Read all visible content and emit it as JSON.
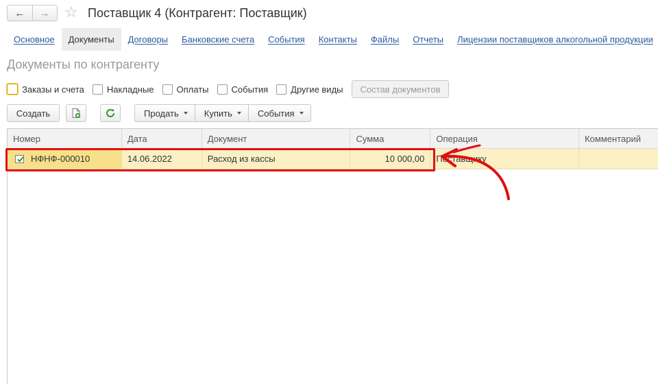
{
  "header": {
    "title": "Поставщик 4 (Контрагент: Поставщик)",
    "back_icon": "←",
    "forward_icon": "→",
    "favorite_icon": "☆"
  },
  "tabs": [
    {
      "label": "Основное",
      "active": false
    },
    {
      "label": "Документы",
      "active": true
    },
    {
      "label": "Договоры",
      "active": false
    },
    {
      "label": "Банковские счета",
      "active": false
    },
    {
      "label": "События",
      "active": false
    },
    {
      "label": "Контакты",
      "active": false
    },
    {
      "label": "Файлы",
      "active": false
    },
    {
      "label": "Отчеты",
      "active": false
    },
    {
      "label": "Лицензии поставщиков алкогольной продукции",
      "active": false
    }
  ],
  "section_title": "Документы по контрагенту",
  "filters": {
    "checkboxes": [
      {
        "label": "Заказы и счета",
        "checked": false
      },
      {
        "label": "Накладные",
        "checked": false
      },
      {
        "label": "Оплаты",
        "checked": false
      },
      {
        "label": "События",
        "checked": false
      },
      {
        "label": "Другие виды",
        "checked": false
      }
    ],
    "composition_button": "Состав документов"
  },
  "toolbar": {
    "create_label": "Создать",
    "sell_label": "Продать",
    "buy_label": "Купить",
    "events_label": "События"
  },
  "table": {
    "columns": [
      "Номер",
      "Дата",
      "Документ",
      "Сумма",
      "Операция",
      "Комментарий"
    ],
    "rows": [
      {
        "number": "НФНФ-000010",
        "date": "14.06.2022",
        "document": "Расход из кассы",
        "amount": "10 000,00",
        "operation": "Поставщику",
        "comment": ""
      }
    ]
  },
  "colors": {
    "link": "#2a5a9c",
    "row_selected": "#fbf0c4",
    "annotation": "#e01010",
    "refresh_icon": "#2e9a2e"
  }
}
